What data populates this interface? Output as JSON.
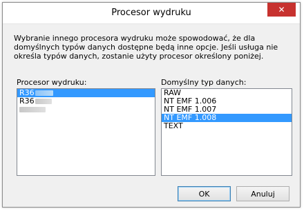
{
  "window": {
    "title": "Procesor wydruku",
    "close_glyph": "✕"
  },
  "info_text": "Wybranie innego procesora wydruku może spowodować, że dla domyślnych typów danych dostępne będą inne opcje. Jeśli usługa nie określa typów danych, zostanie użyty procesor określony poniżej.",
  "processors": {
    "label": "Procesor wydruku:",
    "items": [
      {
        "prefix": "R36",
        "selected": true
      },
      {
        "prefix": "R36",
        "selected": false
      },
      {
        "prefix": "",
        "selected": false
      }
    ]
  },
  "datatypes": {
    "label": "Domyślny typ danych:",
    "items": [
      {
        "text": "RAW",
        "selected": false
      },
      {
        "text": "NT EMF 1.006",
        "selected": false
      },
      {
        "text": "NT EMF 1.007",
        "selected": false
      },
      {
        "text": "NT EMF 1.008",
        "selected": true
      },
      {
        "text": "TEXT",
        "selected": false
      }
    ]
  },
  "buttons": {
    "ok": "OK",
    "cancel": "Anuluj"
  },
  "colors": {
    "selection": "#3399ff",
    "close": "#c7322f"
  }
}
